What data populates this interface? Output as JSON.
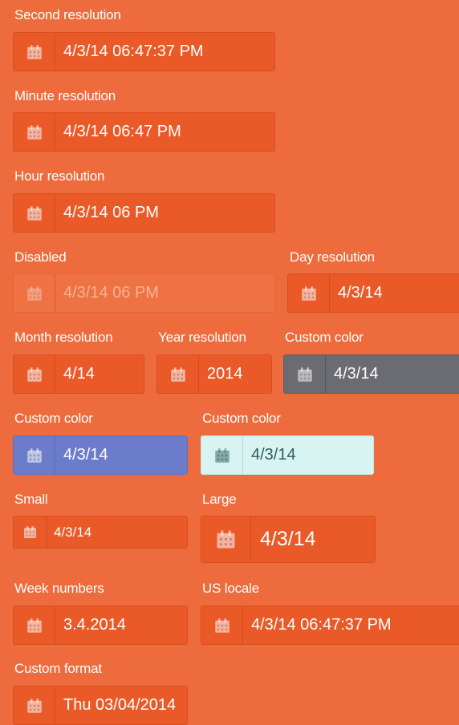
{
  "fields": [
    {
      "label": "Second resolution",
      "value": "4/3/14 06:47:37 PM"
    },
    {
      "label": "Minute resolution",
      "value": "4/3/14 06:47 PM"
    },
    {
      "label": "Hour resolution",
      "value": "4/3/14 06 PM"
    },
    {
      "label": "Disabled",
      "value": "4/3/14 06 PM"
    },
    {
      "label": "Day resolution",
      "value": "4/3/14"
    },
    {
      "label": "Month resolution",
      "value": "4/14"
    },
    {
      "label": "Year resolution",
      "value": "2014"
    },
    {
      "label": "Custom color",
      "value": "4/3/14"
    },
    {
      "label": "Custom color",
      "value": "4/3/14"
    },
    {
      "label": "Custom color",
      "value": "4/3/14"
    },
    {
      "label": "Small",
      "value": "4/3/14"
    },
    {
      "label": "Large",
      "value": "4/3/14"
    },
    {
      "label": "Week numbers",
      "value": "3.4.2014"
    },
    {
      "label": "US locale",
      "value": "4/3/14 06:47:37 PM"
    },
    {
      "label": "Custom format",
      "value": "Thu 03/04/2014"
    }
  ],
  "icons": {
    "calendar": "calendar-icon"
  },
  "colors": {
    "background": "#ee6b3d",
    "field": "#ea5a29",
    "gray": "#6b6b72",
    "blue": "#6b7ccb",
    "mint": "#d7f4f2"
  }
}
